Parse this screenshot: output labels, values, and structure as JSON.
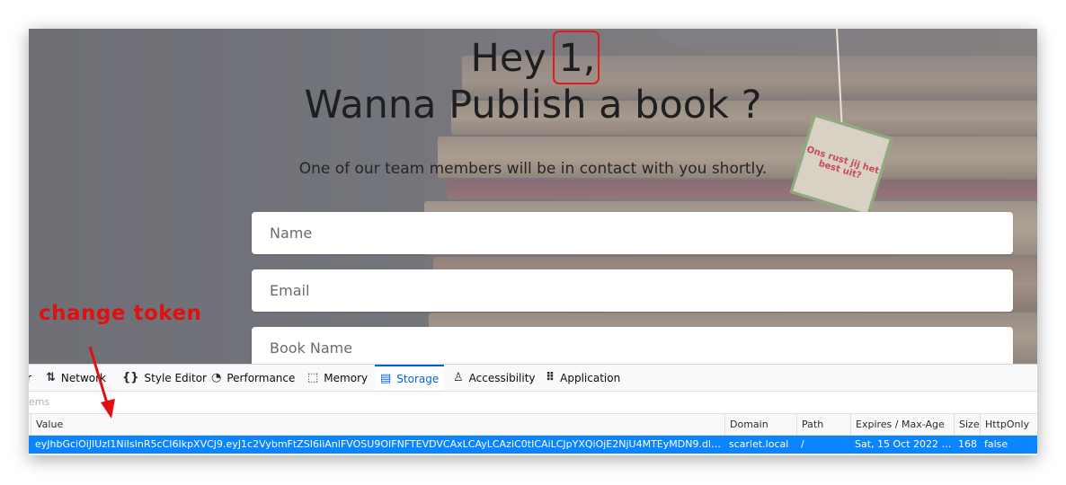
{
  "hero": {
    "greeting": "Hey ",
    "user_id": "1,",
    "question": "Wanna Publish a book ?",
    "subtitle": "One of our team members will be in contact with you shortly.",
    "teabag_text": "Ons rust jij het best uit?"
  },
  "form": {
    "name_placeholder": "Name",
    "email_placeholder": "Email",
    "bookname_placeholder": "Book Name"
  },
  "annotation": {
    "text": "change token",
    "color": "#e01010"
  },
  "devtools": {
    "tabs": [
      {
        "label": "r",
        "icon": "",
        "active": false
      },
      {
        "label": "Network",
        "icon": "network-icon",
        "active": false
      },
      {
        "label": "Style Editor",
        "icon": "braces-icon",
        "active": false
      },
      {
        "label": "Performance",
        "icon": "gauge-icon",
        "active": false
      },
      {
        "label": "Memory",
        "icon": "chip-icon",
        "active": false
      },
      {
        "label": "Storage",
        "icon": "storage-icon",
        "active": true
      },
      {
        "label": "Accessibility",
        "icon": "person-icon",
        "active": false
      },
      {
        "label": "Application",
        "icon": "grid-icon",
        "active": false
      }
    ],
    "filter_text": "ems",
    "columns": [
      "Value",
      "Domain",
      "Path",
      "Expires / Max-Age",
      "Size",
      "HttpOnly"
    ],
    "row": {
      "value": "eyJhbGciOiJIUzI1NiIsInR5cCI6IkpXVCJ9.eyJ1c2VybmFtZSI6IiAnIFVOSU9OIFNFTEVDVCAxLCAyLCAzIC0tICAiLCJpYXQiOjE2NjU4MTEyMDN9.dlKRp_xgSvBz…",
      "domain": "scarlet.local",
      "path": "/",
      "expires": "Sat, 15 Oct 2022 18:…",
      "size": "168",
      "httponly": "false"
    },
    "accent_color": "#0a84ff"
  }
}
